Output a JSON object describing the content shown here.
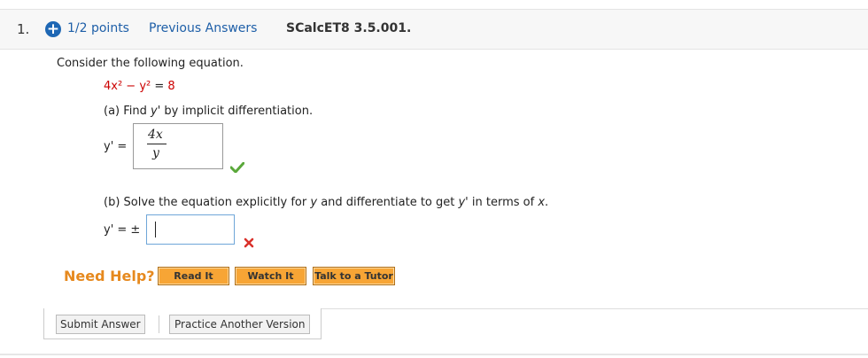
{
  "header": {
    "question_number": "1.",
    "points": "1/2 points",
    "previous_answers": "Previous Answers",
    "code": "SCalcET8 3.5.001."
  },
  "problem": {
    "intro": "Consider the following equation.",
    "equation_lhs": "4x² − y²",
    "equation_eq": " = ",
    "equation_rhs": "8",
    "part_a_prefix": "(a) Find ",
    "part_a_var": "y'",
    "part_a_suffix": " by implicit differentiation.",
    "answer_a_label": "y' =",
    "answer_a_numerator": "4x",
    "answer_a_denominator": "y",
    "answer_a_status": "correct",
    "part_b_prefix": "(b) Solve the equation explicitly for ",
    "part_b_var1": "y",
    "part_b_mid": " and differentiate to get ",
    "part_b_var2": "y'",
    "part_b_mid2": " in terms of ",
    "part_b_var3": "x",
    "part_b_end": ".",
    "answer_b_label": "y' = ±",
    "answer_b_value": "",
    "answer_b_status": "incorrect"
  },
  "help": {
    "label": "Need Help?",
    "buttons": [
      "Read It",
      "Watch It",
      "Talk to a Tutor"
    ]
  },
  "actions": {
    "submit": "Submit Answer",
    "practice": "Practice Another Version"
  },
  "colors": {
    "link": "#1e5fa8",
    "accent": "#1e67b4",
    "need_help": "#e6891e",
    "help_button": "#f7a535",
    "correct": "#5aa83a",
    "incorrect": "#d9312b"
  }
}
